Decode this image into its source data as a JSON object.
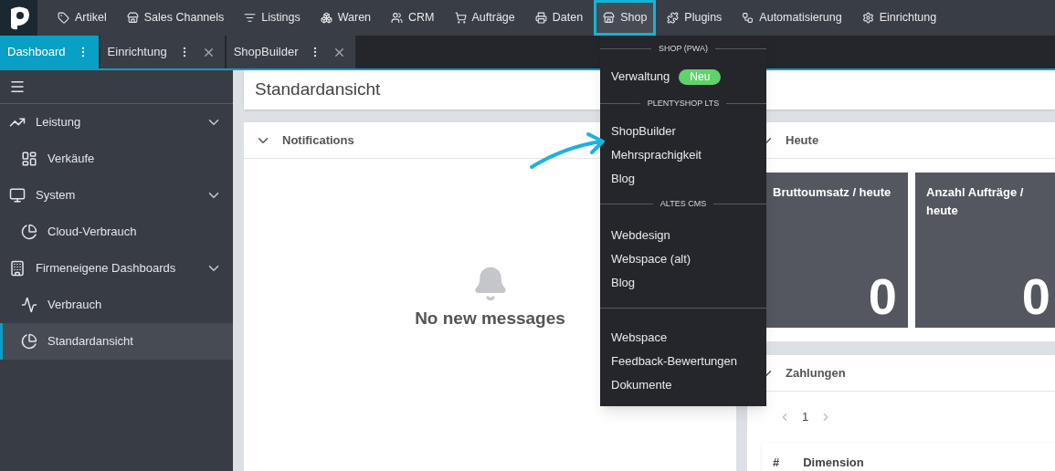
{
  "top_nav": [
    {
      "label": "Artikel",
      "selected": false
    },
    {
      "label": "Sales Channels",
      "selected": false
    },
    {
      "label": "Listings",
      "selected": false
    },
    {
      "label": "Waren",
      "selected": false
    },
    {
      "label": "CRM",
      "selected": false
    },
    {
      "label": "Aufträge",
      "selected": false
    },
    {
      "label": "Daten",
      "selected": false
    },
    {
      "label": "Shop",
      "selected": true
    },
    {
      "label": "Plugins",
      "selected": false
    },
    {
      "label": "Automatisierung",
      "selected": false
    },
    {
      "label": "Einrichtung",
      "selected": false
    }
  ],
  "tabs": [
    {
      "label": "Dashboard",
      "selected": true,
      "closable": false
    },
    {
      "label": "Einrichtung",
      "selected": false,
      "closable": true
    },
    {
      "label": "ShopBuilder",
      "selected": false,
      "closable": true
    }
  ],
  "sidebar": {
    "items": [
      {
        "label": "Leistung",
        "expanded": true,
        "selected": false,
        "children": [
          {
            "label": "Verkäufe",
            "selected": false
          }
        ]
      },
      {
        "label": "System",
        "expanded": true,
        "selected": false,
        "children": [
          {
            "label": "Cloud-Verbrauch",
            "selected": false
          }
        ]
      },
      {
        "label": "Firmeneigene Dashboards",
        "expanded": true,
        "selected": false,
        "children": [
          {
            "label": "Verbrauch",
            "selected": false
          },
          {
            "label": "Standardansicht",
            "selected": true
          }
        ]
      }
    ]
  },
  "page_title": "Standardansicht",
  "notifications": {
    "title": "Notifications",
    "expanded": true,
    "empty_text": "No new messages"
  },
  "today": {
    "title": "Heute",
    "expanded": true,
    "tiles": [
      {
        "title": "Bruttoumsatz / heute",
        "value": "0"
      },
      {
        "title": "Anzahl Aufträge / heute",
        "value": "0"
      }
    ]
  },
  "payments": {
    "title": "Zahlungen",
    "expanded": true,
    "page": "1",
    "columns": [
      "#",
      "Dimension"
    ]
  },
  "shop_menu": {
    "sections": [
      {
        "heading": "SHOP (PWA)",
        "items": [
          {
            "label": "Verwaltung",
            "badge": "Neu"
          }
        ]
      },
      {
        "heading": "PLENTYSHOP LTS",
        "items": [
          {
            "label": "ShopBuilder"
          },
          {
            "label": "Mehrsprachigkeit"
          },
          {
            "label": "Blog"
          }
        ]
      },
      {
        "heading": "ALTES CMS",
        "items": [
          {
            "label": "Webdesign"
          },
          {
            "label": "Webspace (alt)"
          },
          {
            "label": "Blog"
          }
        ]
      },
      {
        "items": [
          {
            "label": "Webspace"
          },
          {
            "label": "Feedback-Bewertungen"
          },
          {
            "label": "Dokumente"
          }
        ]
      }
    ]
  }
}
